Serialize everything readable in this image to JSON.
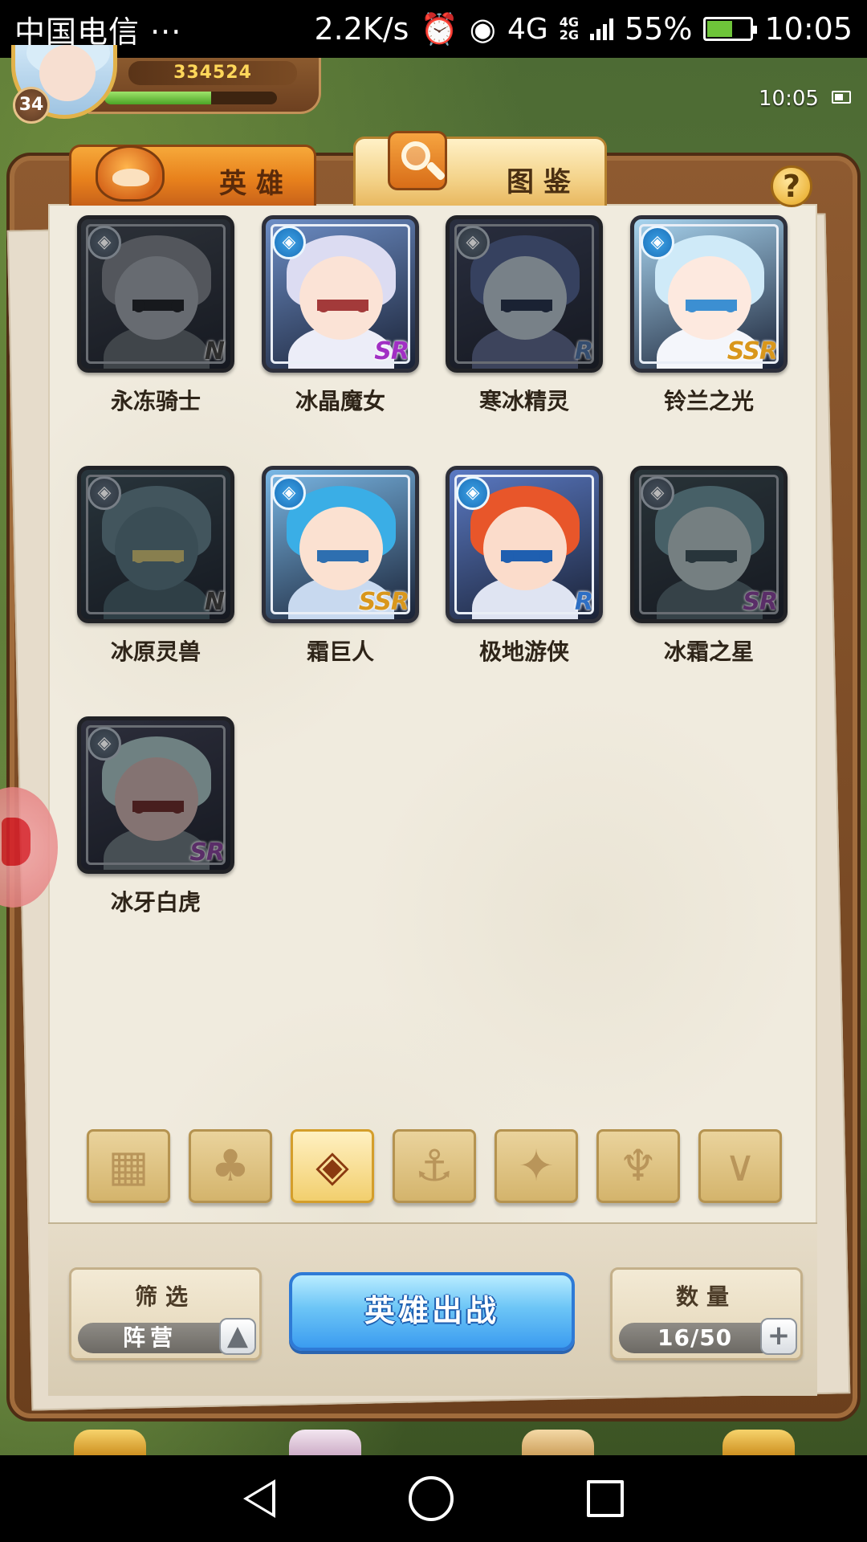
{
  "status_bar": {
    "carrier": "中国电信 ···",
    "speed": "2.2K/s",
    "network": "4G",
    "network_small_1": "4G",
    "network_small_2": "2G",
    "battery": "55%",
    "time": "10:05",
    "icons": [
      "alarm-icon",
      "eye-icon",
      "signal-icon",
      "battery-icon"
    ]
  },
  "hud": {
    "level": "34",
    "power": "334524",
    "exp_progress": 0.62,
    "game_time": "10:05"
  },
  "tabs": [
    {
      "label": "英雄",
      "icon": "helmet-icon",
      "active": false
    },
    {
      "label": "图鉴",
      "icon": "magnifier-icon",
      "active": true
    }
  ],
  "help_label": "?",
  "heroes": [
    {
      "name": "永冻骑士",
      "rarity": "N",
      "unlocked": false,
      "colors": {
        "hair": "#6f7886",
        "head": "#8c95a3",
        "body": "#55606e",
        "eyes": "#1d232c",
        "bg": "#3a4658"
      }
    },
    {
      "name": "冰晶魔女",
      "rarity": "SR",
      "unlocked": true,
      "colors": {
        "hair": "#dcdcf2",
        "head": "#fbe3d6",
        "body": "#ecedf8",
        "eyes": "#a33a3a",
        "bg": "#6d8ec6"
      }
    },
    {
      "name": "寒冰精灵",
      "rarity": "R",
      "unlocked": false,
      "colors": {
        "hair": "#3f5aa6",
        "head": "#9fb4c7",
        "body": "#4c5e9a",
        "eyes": "#1d2f5a",
        "bg": "#34406a"
      }
    },
    {
      "name": "铃兰之光",
      "rarity": "SSR",
      "unlocked": true,
      "colors": {
        "hair": "#cfeaf8",
        "head": "#fde9df",
        "body": "#f4f6fb",
        "eyes": "#3c8fd2",
        "bg": "#a8d4ef"
      }
    },
    {
      "name": "冰原灵兽",
      "rarity": "N",
      "unlocked": false,
      "colors": {
        "hair": "#4a7a8e",
        "head": "#3f6f84",
        "body": "#335a6c",
        "eyes": "#c9b23a",
        "bg": "#2c4c5c"
      }
    },
    {
      "name": "霜巨人",
      "rarity": "SSR",
      "unlocked": true,
      "colors": {
        "hair": "#3aaee6",
        "head": "#fbe1d1",
        "body": "#c8d9ef",
        "eyes": "#2e6fb0",
        "bg": "#7ab8e6"
      }
    },
    {
      "name": "极地游侠",
      "rarity": "R",
      "unlocked": true,
      "colors": {
        "hair": "#e8562a",
        "head": "#fbdccb",
        "body": "#dfe4f2",
        "eyes": "#1f5fb0",
        "bg": "#5b7ac4"
      }
    },
    {
      "name": "冰霜之星",
      "rarity": "SR",
      "unlocked": false,
      "colors": {
        "hair": "#4c8a9e",
        "head": "#9ab3b7",
        "body": "#3f5f6c",
        "eyes": "#2a4d5c",
        "bg": "#2f4a56"
      }
    },
    {
      "name": "冰牙白虎",
      "rarity": "SR",
      "unlocked": false,
      "colors": {
        "hair": "#8ab8ba",
        "head": "#c79c98",
        "body": "#5b6f7c",
        "eyes": "#8a2020",
        "bg": "#3b3f60"
      }
    }
  ],
  "camp_filters": [
    {
      "icon": "grid-icon",
      "glyph": "▦",
      "active": false
    },
    {
      "icon": "leaf-icon",
      "glyph": "♣",
      "active": false
    },
    {
      "icon": "ice-crystal-icon",
      "glyph": "◈",
      "active": true
    },
    {
      "icon": "anchor-icon",
      "glyph": "⚓",
      "active": false
    },
    {
      "icon": "beast-icon",
      "glyph": "✦",
      "active": false
    },
    {
      "icon": "horn-icon",
      "glyph": "♆",
      "active": false
    },
    {
      "icon": "wing-icon",
      "glyph": "∨",
      "active": false
    }
  ],
  "filter_panel": {
    "title": "筛选",
    "value": "阵营",
    "button": "▲"
  },
  "deploy_button": "英雄出战",
  "count_panel": {
    "title": "数量",
    "value": "16/50",
    "button": "+"
  },
  "colors": {
    "accent_orange": "#e8811c",
    "deploy_blue": "#3b9cf0",
    "page_bg": "#f0ebde"
  }
}
